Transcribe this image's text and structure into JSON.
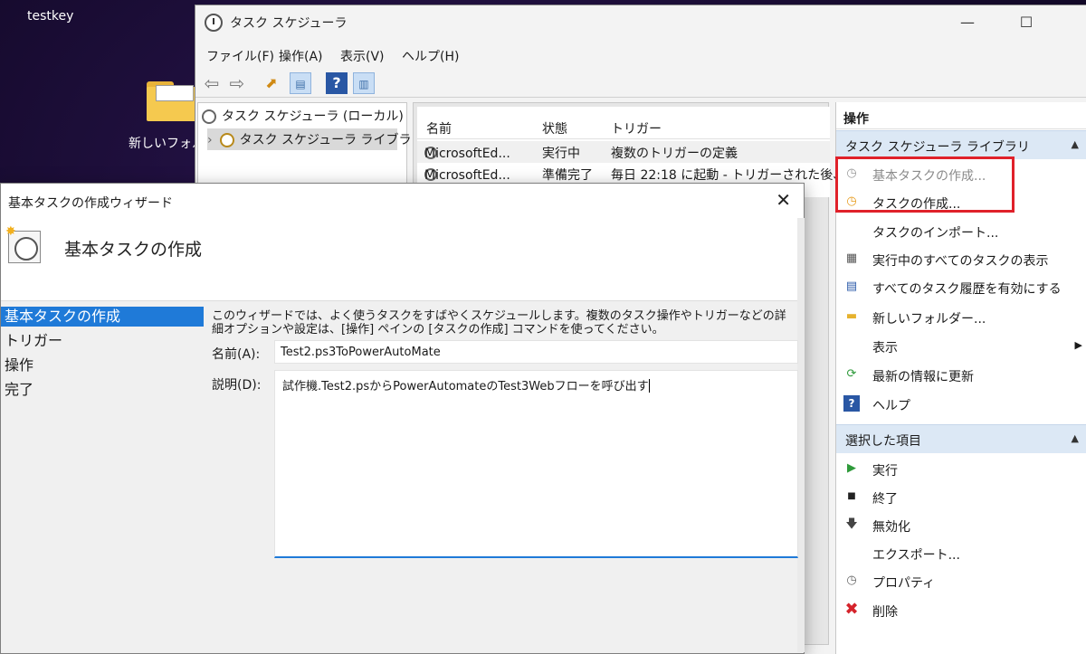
{
  "desktop": {
    "user": "testkey",
    "folder_label": "新しいフォル"
  },
  "window": {
    "title": "タスク スケジューラ",
    "controls": {
      "minimize": "—",
      "maximize": "☐"
    }
  },
  "menu": [
    "ファイル(F)",
    "操作(A)",
    "表示(V)",
    "ヘルプ(H)"
  ],
  "toolbar": {
    "back": "⇦",
    "forward": "⇨",
    "help": "?"
  },
  "tree": {
    "root": "タスク スケジューラ (ローカル)",
    "expander": "›",
    "child": "タスク スケジューラ ライブラリ"
  },
  "task_list": {
    "columns": [
      "名前",
      "状態",
      "トリガー"
    ],
    "rows": [
      {
        "name": "MicrosoftEd...",
        "status": "実行中",
        "trigger": "複数のトリガーの定義"
      },
      {
        "name": "MicrosoftEd...",
        "status": "準備完了",
        "trigger": "毎日 22:18 に起動 - トリガーされた後、"
      }
    ]
  },
  "actions": {
    "header": "操作",
    "library_section": "タスク スケジューラ ライブラリ",
    "library_items": [
      {
        "label": "基本タスクの作成...",
        "icon": "clock-star-icon"
      },
      {
        "label": "タスクの作成...",
        "icon": "clock-icon"
      },
      {
        "label": "タスクのインポート...",
        "icon": ""
      },
      {
        "label": "実行中のすべてのタスクの表示",
        "icon": "list-icon"
      },
      {
        "label": "すべてのタスク履歴を有効にする",
        "icon": "history-icon"
      },
      {
        "label": "新しいフォルダー...",
        "icon": "folder-icon"
      },
      {
        "label": "表示",
        "icon": ""
      },
      {
        "label": "最新の情報に更新",
        "icon": "refresh-icon"
      },
      {
        "label": "ヘルプ",
        "icon": "help-icon"
      }
    ],
    "submenu_arrow": "▶",
    "collapse_caret": "▲",
    "selected_section": "選択した項目",
    "selected_items": [
      {
        "label": "実行",
        "icon": "▶"
      },
      {
        "label": "終了",
        "icon": "■"
      },
      {
        "label": "無効化",
        "icon": "🡇"
      },
      {
        "label": "エクスポート...",
        "icon": ""
      },
      {
        "label": "プロパティ",
        "icon": "◷"
      },
      {
        "label": "削除",
        "icon": "✖"
      }
    ]
  },
  "wizard": {
    "title": "基本タスクの作成ウィザード",
    "close": "✕",
    "heading": "基本タスクの作成",
    "steps": [
      "基本タスクの作成",
      "トリガー",
      "操作",
      "完了"
    ],
    "description": "このウィザードでは、よく使うタスクをすばやくスケジュールします。複数のタスク操作やトリガーなどの詳細オプションや設定は、[操作] ペインの [タスクの作成] コマンドを使ってください。",
    "name_label": "名前(A):",
    "name_value": "Test2.ps3ToPowerAutoMate",
    "desc_label": "説明(D):",
    "desc_value": "試作機.Test2.psからPowerAutomateのTest3Webフローを呼び出す"
  },
  "colors": {
    "selection_blue": "#1f7ad8",
    "section_blue": "#dce8f5",
    "highlight_red": "#e0212a"
  }
}
